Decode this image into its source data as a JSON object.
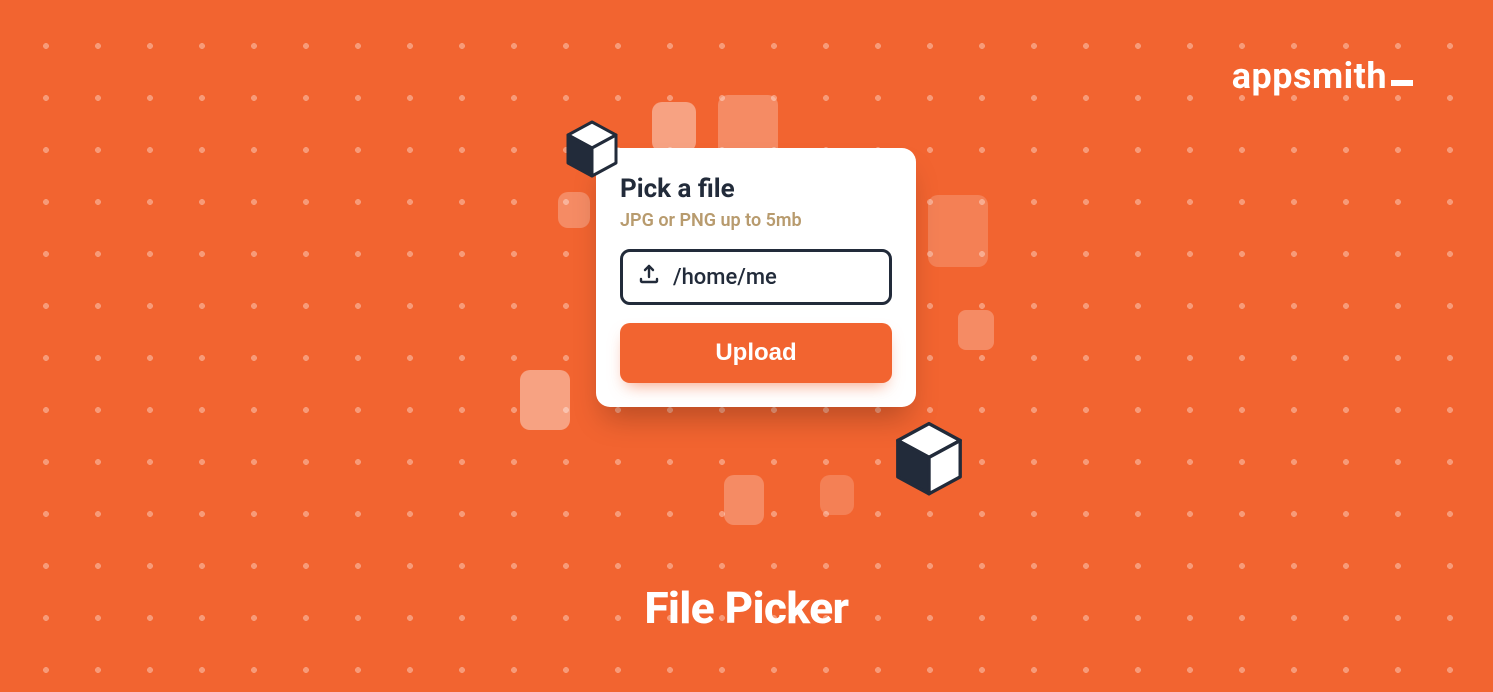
{
  "brand": {
    "name": "appsmith"
  },
  "card": {
    "title": "Pick a file",
    "subtitle": "JPG or PNG up to 5mb",
    "path": "/home/me",
    "upload_label": "Upload"
  },
  "caption": "File Picker",
  "colors": {
    "accent": "#F26430",
    "dark": "#222B3A",
    "muted": "#B89B6E"
  }
}
